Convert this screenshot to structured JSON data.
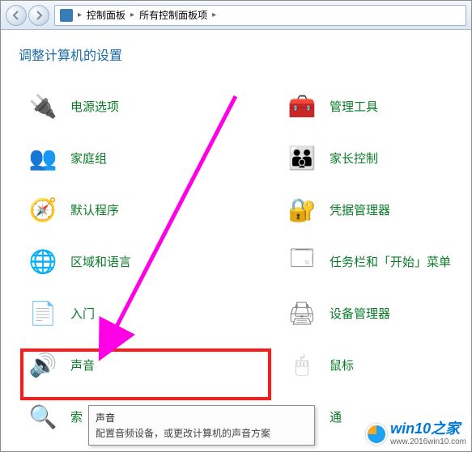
{
  "address": {
    "crumb1": "控制面板",
    "crumb2": "所有控制面板项"
  },
  "heading": "调整计算机的设置",
  "items_left": [
    {
      "label": "电源选项",
      "name": "item-power",
      "iconName": "power-icon",
      "iconClass": "ic-power",
      "glyph": "🔌"
    },
    {
      "label": "家庭组",
      "name": "item-homegroup",
      "iconName": "home-icon",
      "iconClass": "ic-home",
      "glyph": "👥"
    },
    {
      "label": "默认程序",
      "name": "item-default-programs",
      "iconName": "programs-icon",
      "iconClass": "ic-prog",
      "glyph": "🧭"
    },
    {
      "label": "区域和语言",
      "name": "item-region-language",
      "iconName": "region-icon",
      "iconClass": "ic-region",
      "glyph": "🌐"
    },
    {
      "label": "入门",
      "name": "item-getting-started",
      "iconName": "intro-icon",
      "iconClass": "ic-intro",
      "glyph": "📄"
    },
    {
      "label": "声音",
      "name": "item-sound",
      "iconName": "sound-icon",
      "iconClass": "ic-sound",
      "glyph": "🔊"
    },
    {
      "label": "索",
      "name": "item-index",
      "iconName": "search-icon",
      "iconClass": "ic-search",
      "glyph": "🔍"
    }
  ],
  "items_right": [
    {
      "label": "管理工具",
      "name": "item-admin-tools",
      "iconName": "admin-icon",
      "iconClass": "ic-admin",
      "glyph": "🧰"
    },
    {
      "label": "家长控制",
      "name": "item-parental",
      "iconName": "parental-icon",
      "iconClass": "ic-parent",
      "glyph": "👪"
    },
    {
      "label": "凭据管理器",
      "name": "item-credentials",
      "iconName": "credentials-icon",
      "iconClass": "ic-cred",
      "glyph": "🔐"
    },
    {
      "label": "任务栏和「开始」菜单",
      "name": "item-taskbar-start",
      "iconName": "taskbar-icon",
      "iconClass": "ic-task",
      "glyph": "🗔"
    },
    {
      "label": "设备管理器",
      "name": "item-device-manager",
      "iconName": "devmgr-icon",
      "iconClass": "ic-devmgr",
      "glyph": "🖨"
    },
    {
      "label": "鼠标",
      "name": "item-mouse",
      "iconName": "mouse-icon",
      "iconClass": "ic-mouse",
      "glyph": "🖱"
    },
    {
      "label": "通",
      "name": "item-notification",
      "iconName": "notif-icon",
      "iconClass": "ic-notif",
      "glyph": "🖥"
    }
  ],
  "tooltip": {
    "title": "声音",
    "desc": "配置音频设备，或更改计算机的声音方案"
  },
  "watermark": {
    "brand": "win10之家",
    "url": "www.2016win10.com"
  },
  "annotation": {
    "highlight_color": "#ff1a1a",
    "arrow_color": "#ff00e6"
  }
}
